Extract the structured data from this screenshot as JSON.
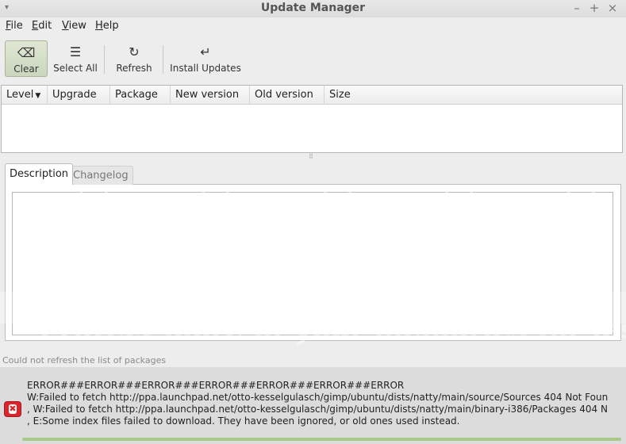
{
  "window": {
    "title": "Update Manager",
    "menu_glyph": "▾",
    "minimize": "–",
    "maximize": "+",
    "close": "×"
  },
  "menubar": [
    {
      "mnemonic": "F",
      "rest": "ile"
    },
    {
      "mnemonic": "E",
      "rest": "dit"
    },
    {
      "mnemonic": "V",
      "rest": "iew"
    },
    {
      "mnemonic": "H",
      "rest": "elp"
    }
  ],
  "toolbar": {
    "clear_label": "Clear",
    "select_all_label": "Select All",
    "refresh_label": "Refresh",
    "install_label": "Install Updates",
    "clear_icon": "⌫",
    "select_all_icon": "☰",
    "refresh_icon": "↻",
    "install_icon": "↵"
  },
  "package_list": {
    "columns": [
      "Level",
      "Upgrade",
      "Package",
      "New version",
      "Old version",
      "Size"
    ],
    "sort_arrow": "▼",
    "rows": []
  },
  "pane_grip": "⠿",
  "tabs": {
    "description": "Description",
    "changelog": "Changelog"
  },
  "watermark": {
    "text": "Protect more of your memories for less!",
    "dots": "◯ ◯ ◯ ◯ ◯ ◯ ◯"
  },
  "status": {
    "message": "Could not refresh the list of packages",
    "error_lines": [
      "ERROR###ERROR###ERROR###ERROR###ERROR###ERROR###ERROR",
      "W:Failed to fetch http://ppa.launchpad.net/otto-kesselgulasch/gimp/ubuntu/dists/natty/main/source/Sources  404  Not Foun",
      ", W:Failed to fetch http://ppa.launchpad.net/otto-kesselgulasch/gimp/ubuntu/dists/natty/main/binary-i386/Packages  404  N",
      ", E:Some index files failed to download. They have been ignored, or old ones used instead."
    ],
    "error_icon_glyph": "✖"
  },
  "colors": {
    "accent": "#a9c98a",
    "error": "#d9262b"
  }
}
